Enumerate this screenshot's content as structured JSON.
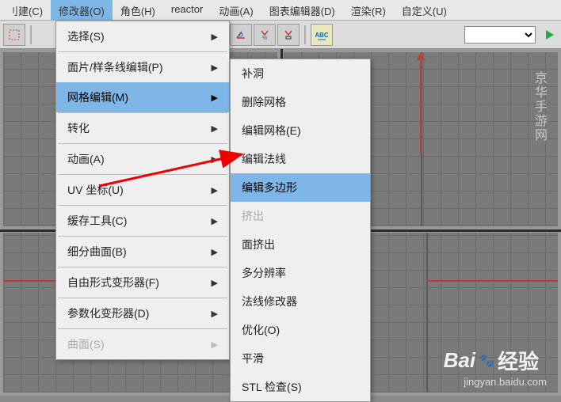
{
  "menubar": {
    "items": [
      {
        "label": "刂建(C)"
      },
      {
        "label": "修改器(O)",
        "active": true
      },
      {
        "label": "角色(H)"
      },
      {
        "label": "reactor"
      },
      {
        "label": "动画(A)"
      },
      {
        "label": "图表编辑器(D)"
      },
      {
        "label": "渲染(R)"
      },
      {
        "label": "自定义(U)"
      }
    ]
  },
  "dropdown": {
    "items": [
      {
        "label": "选择(S)",
        "hasSub": true
      },
      {
        "sep": true
      },
      {
        "label": "面片/样条线编辑(P)",
        "hasSub": true
      },
      {
        "label": "网格编辑(M)",
        "hasSub": true,
        "highlighted": true
      },
      {
        "sep": true
      },
      {
        "label": "转化",
        "hasSub": true
      },
      {
        "sep": true
      },
      {
        "label": "动画(A)",
        "hasSub": true
      },
      {
        "sep": true
      },
      {
        "label": "UV 坐标(U)",
        "hasSub": true
      },
      {
        "sep": true
      },
      {
        "label": "缓存工具(C)",
        "hasSub": true
      },
      {
        "sep": true
      },
      {
        "label": "细分曲面(B)",
        "hasSub": true
      },
      {
        "sep": true
      },
      {
        "label": "自由形式变形器(F)",
        "hasSub": true
      },
      {
        "sep": true
      },
      {
        "label": "参数化变形器(D)",
        "hasSub": true
      },
      {
        "sep": true
      },
      {
        "label": "曲面(S)",
        "hasSub": true,
        "disabled": true
      }
    ]
  },
  "submenu": {
    "items": [
      {
        "label": "补洞"
      },
      {
        "label": "删除网格"
      },
      {
        "label": "编辑网格(E)"
      },
      {
        "label": "编辑法线"
      },
      {
        "label": "编辑多边形",
        "highlighted": true
      },
      {
        "label": "挤出",
        "disabled": true
      },
      {
        "label": "面挤出"
      },
      {
        "label": "多分辨率"
      },
      {
        "label": "法线修改器"
      },
      {
        "label": "优化(O)"
      },
      {
        "label": "平滑"
      },
      {
        "label": "STL 检查(S)"
      }
    ]
  },
  "watermark": {
    "brand_a": "Bai",
    "brand_b": "经验",
    "url": "jingyan.baidu.com",
    "side": "京华手游网"
  }
}
